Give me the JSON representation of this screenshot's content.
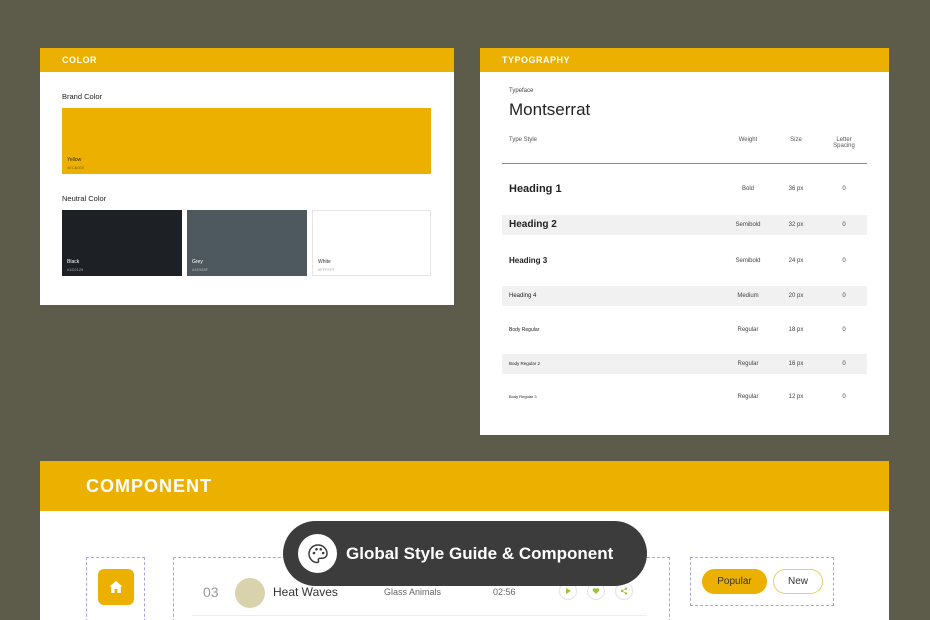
{
  "colors": {
    "background": "#5d5c4b",
    "accent_yellow": "#ecb000",
    "black": "#1d2125",
    "grey": "#4e585f",
    "white": "#ffffff"
  },
  "color_panel": {
    "header": "COLOR",
    "brand_label": "Brand Color",
    "brand_swatch": {
      "name": "Yellow",
      "hex": "#ECB000"
    },
    "neutral_label": "Neutral Color",
    "neutral_swatches": [
      {
        "name": "Black",
        "hex": "#1D2125"
      },
      {
        "name": "Grey",
        "hex": "#4E585F"
      },
      {
        "name": "White",
        "hex": "#FFFFFF"
      }
    ]
  },
  "typography_panel": {
    "header": "TYPOGRAPHY",
    "typeface_label": "Typeface",
    "typeface_name": "Montserrat",
    "columns": {
      "type_style": "Type Style",
      "weight": "Weight",
      "size": "Size",
      "letter_spacing_line1": "Letter",
      "letter_spacing_line2": "Spacing"
    },
    "rows": [
      {
        "style": "Heading 1",
        "weight": "Bold",
        "size": "36 px",
        "spacing": "0"
      },
      {
        "style": "Heading 2",
        "weight": "Semibold",
        "size": "32 px",
        "spacing": "0"
      },
      {
        "style": "Heading 3",
        "weight": "Semibold",
        "size": "24 px",
        "spacing": "0"
      },
      {
        "style": "Heading 4",
        "weight": "Medium",
        "size": "20 px",
        "spacing": "0"
      },
      {
        "style": "Body Regular",
        "weight": "Regular",
        "size": "18 px",
        "spacing": "0"
      },
      {
        "style": "Body Regular 2",
        "weight": "Regular",
        "size": "16 px",
        "spacing": "0"
      },
      {
        "style": "Body Regular 3",
        "weight": "Regular",
        "size": "12 px",
        "spacing": "0"
      }
    ]
  },
  "component_panel": {
    "header": "COMPONENT",
    "home_icon": "home-icon",
    "track": {
      "number": "03",
      "title": "Heat Waves",
      "artist": "Glass Animals",
      "duration": "02:56",
      "actions": [
        "play-icon",
        "heart-icon",
        "share-icon"
      ]
    },
    "tags": [
      "Popular",
      "New"
    ]
  },
  "overlay": {
    "icon": "palette-icon",
    "text": "Global Style Guide & Component"
  }
}
